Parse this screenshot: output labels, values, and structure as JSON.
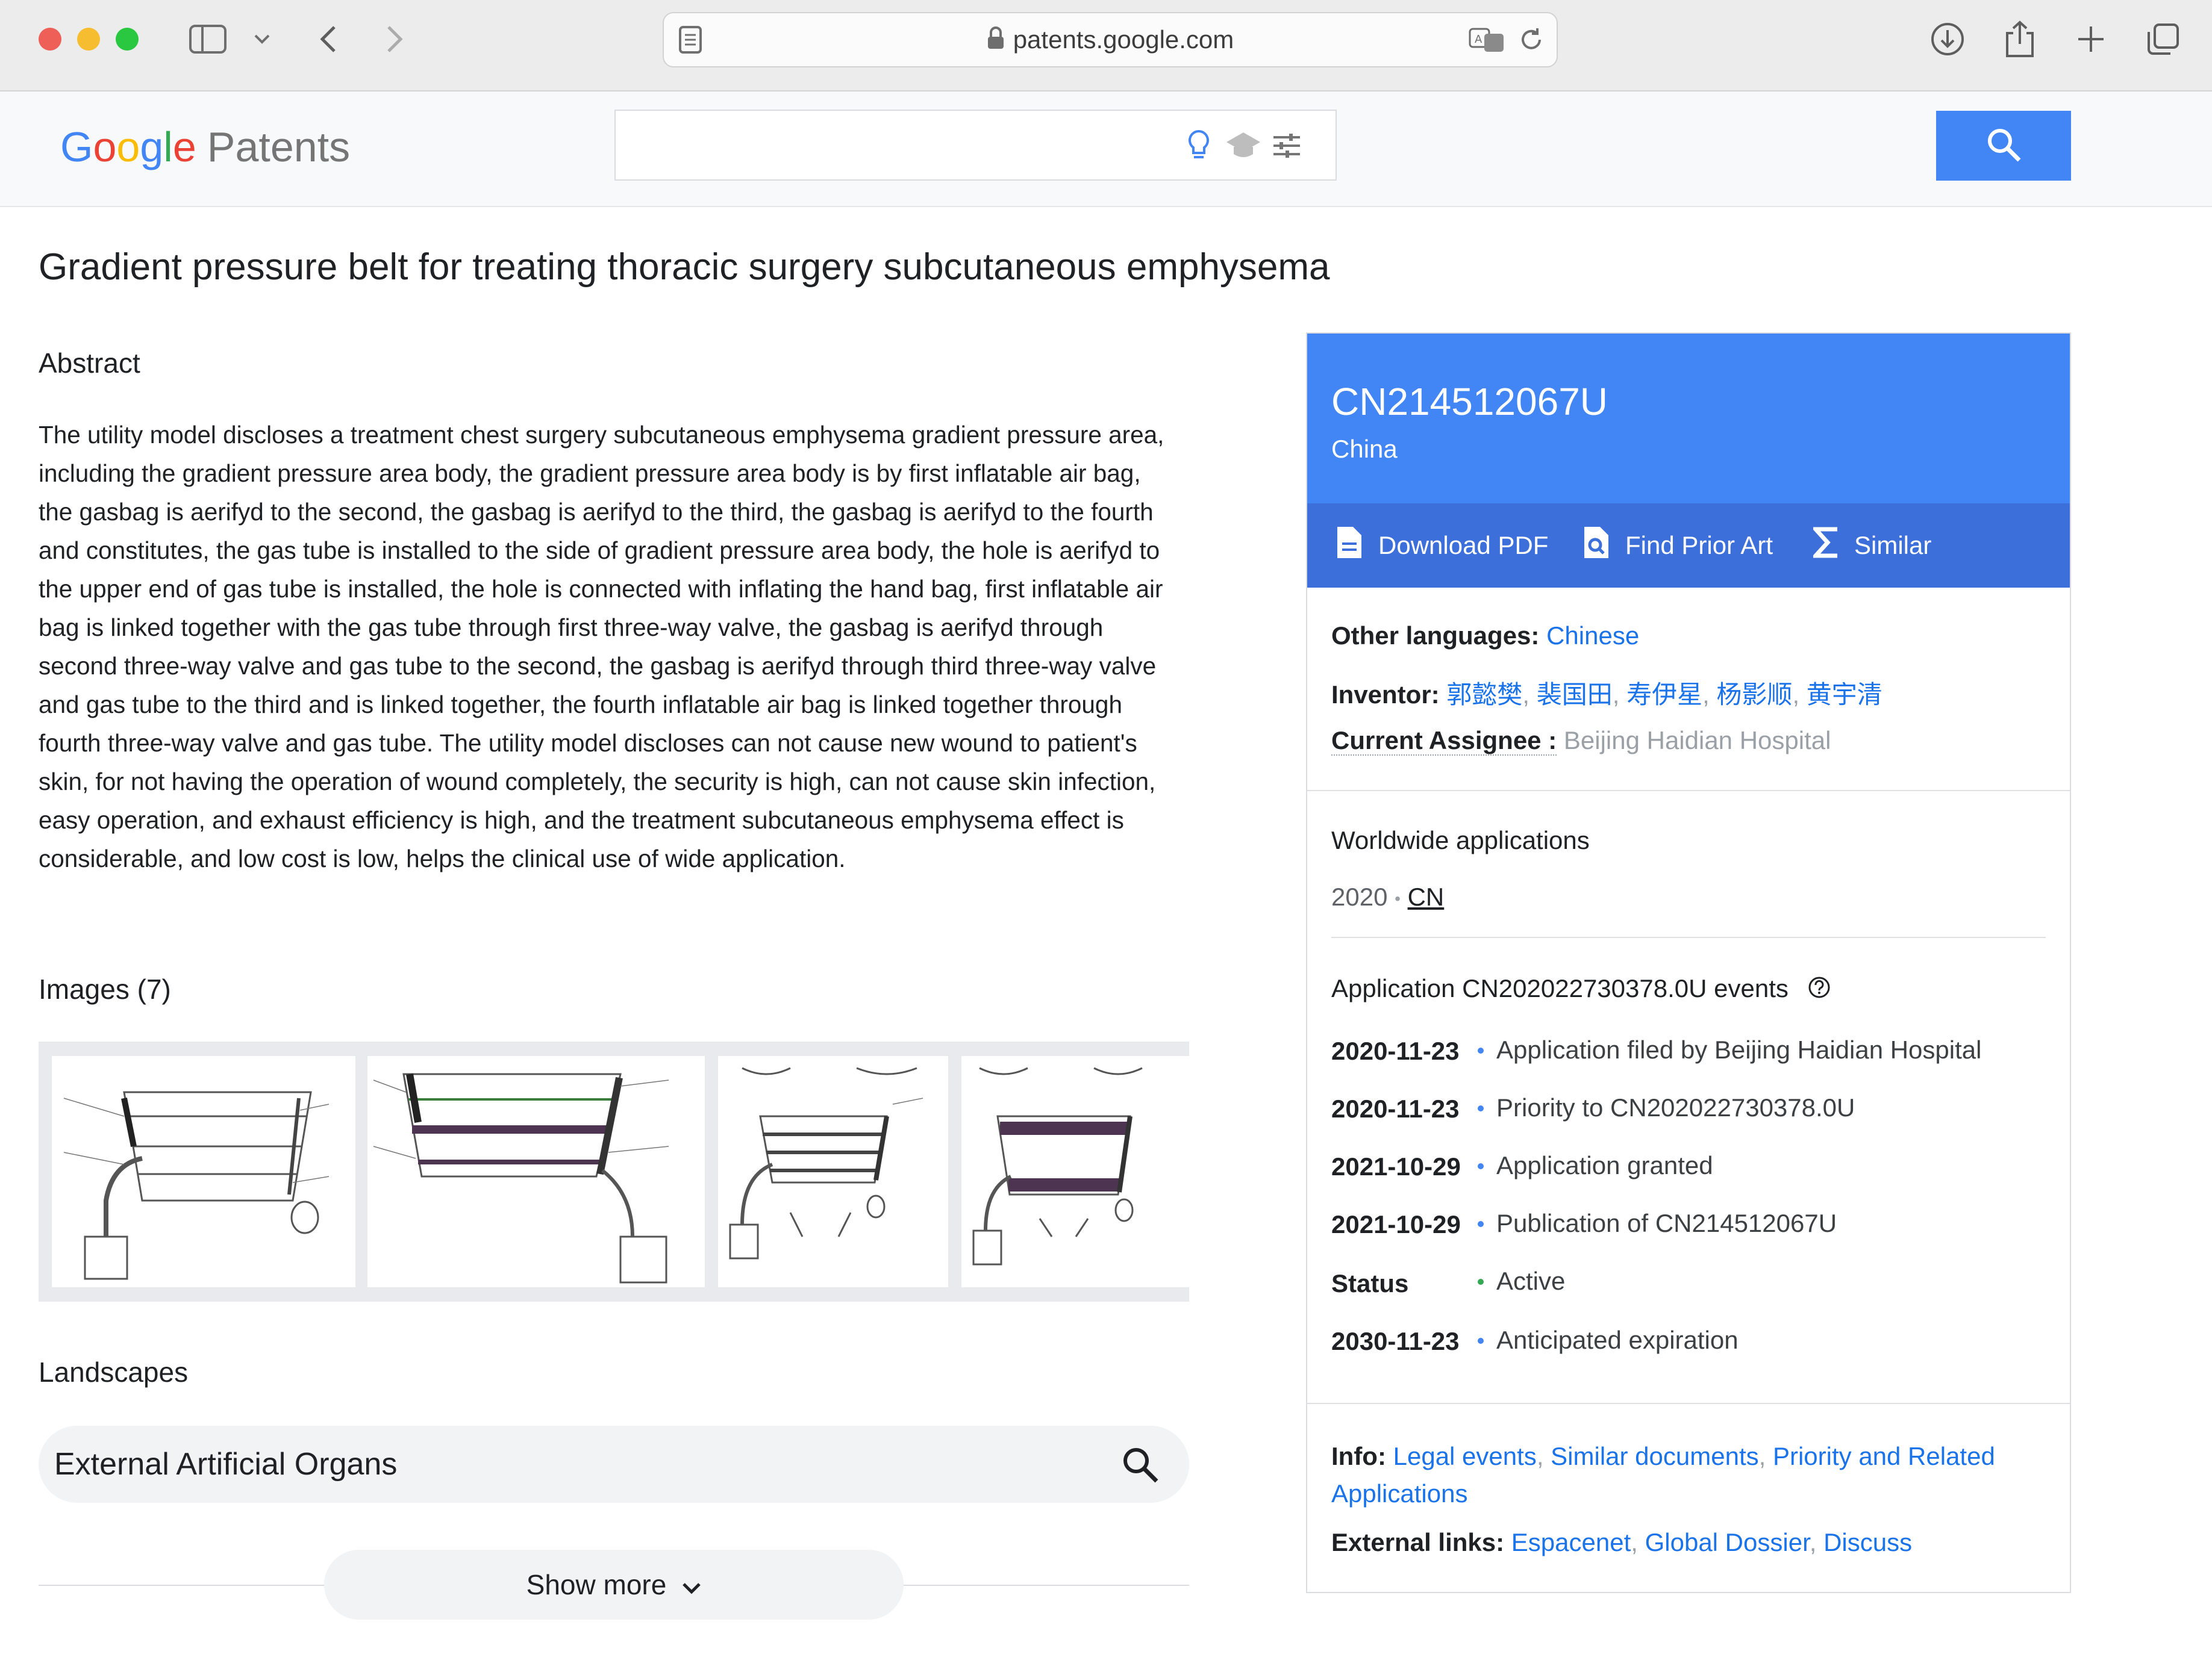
{
  "browser": {
    "url": "patents.google.com"
  },
  "header": {
    "logo_google": "Google",
    "logo_patents": "Patents",
    "search_value": ""
  },
  "patent": {
    "title": "Gradient pressure belt for treating thoracic surgery subcutaneous emphysema",
    "abstract_heading": "Abstract",
    "abstract": "The utility model discloses a treatment chest surgery subcutaneous emphysema gradient pressure area, including the gradient pressure area body, the gradient pressure area body is by first inflatable air bag, the gasbag is aerifyd to the second, the gasbag is aerifyd to the third, the gasbag is aerifyd to the fourth and constitutes, the gas tube is installed to the side of gradient pressure area body, the hole is aerifyd to the upper end of gas tube is installed, the hole is connected with inflating the hand bag, first inflatable air bag is linked together with the gas tube through first three-way valve, the gasbag is aerifyd through second three-way valve and gas tube to the second, the gasbag is aerifyd through third three-way valve and gas tube to the third and is linked together, the fourth inflatable air bag is linked together through fourth three-way valve and gas tube. The utility model discloses can not cause new wound to patient's skin, for not having the operation of wound completely, the security is high, can not cause skin infection, easy operation, and exhaust efficiency is high, and the treatment subcutaneous emphysema effect is considerable, and low cost is low, helps the clinical use of wide application.",
    "images_heading": "Images (7)",
    "landscapes_heading": "Landscapes",
    "landscape_item": "External Artificial Organs",
    "show_more": "Show more"
  },
  "card": {
    "number": "CN214512067U",
    "country": "China",
    "actions": {
      "download": "Download PDF",
      "prior_art": "Find Prior Art",
      "similar": "Similar"
    },
    "other_languages_label": "Other languages:",
    "other_languages_value": "Chinese",
    "inventor_label": "Inventor:",
    "inventors": [
      "郭懿樊",
      "裴国田",
      "寿伊星",
      "杨影顺",
      "黄宇清"
    ],
    "assignee_label": "Current Assignee :",
    "assignee_value": "Beijing Haidian Hospital",
    "worldwide_heading": "Worldwide applications",
    "worldwide_year": "2020",
    "worldwide_country": "CN",
    "events_heading": "Application CN202022730378.0U events",
    "events": [
      {
        "date": "2020-11-23",
        "text": "Application filed by Beijing Haidian Hospital"
      },
      {
        "date": "2020-11-23",
        "text": "Priority to CN202022730378.0U"
      },
      {
        "date": "2021-10-29",
        "text": "Application granted"
      },
      {
        "date": "2021-10-29",
        "text": "Publication of CN214512067U"
      },
      {
        "date": "Status",
        "text": "Active"
      },
      {
        "date": "2030-11-23",
        "text": "Anticipated expiration"
      }
    ],
    "info_label": "Info:",
    "info_links": [
      "Legal events",
      "Similar documents",
      "Priority and Related Applications"
    ],
    "external_label": "External links:",
    "external_links": [
      "Espacenet",
      "Global Dossier",
      "Discuss"
    ]
  },
  "colors": {
    "brand_blue": "#4285f4",
    "link_blue": "#1a73e8",
    "status_green": "#34a853"
  }
}
